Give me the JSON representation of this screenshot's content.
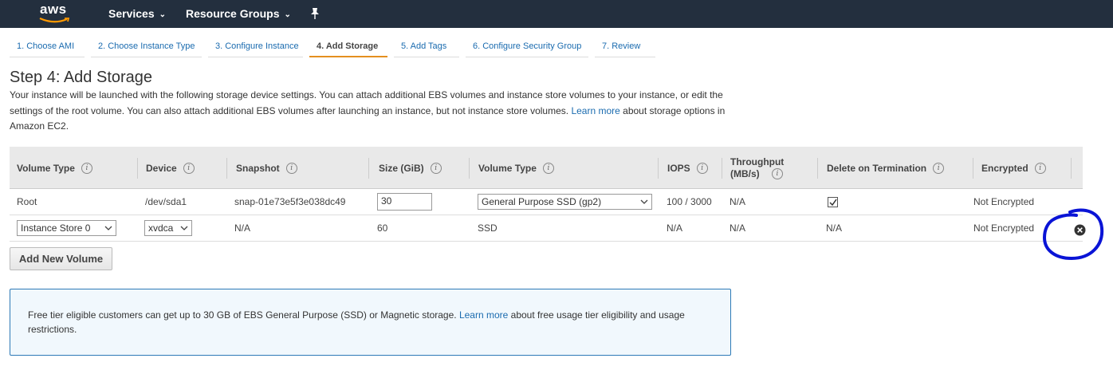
{
  "nav": {
    "logo": "aws",
    "items": [
      {
        "label": "Services"
      },
      {
        "label": "Resource Groups"
      }
    ]
  },
  "tabs": [
    {
      "label": "1. Choose AMI",
      "active": false
    },
    {
      "label": "2. Choose Instance Type",
      "active": false
    },
    {
      "label": "3. Configure Instance",
      "active": false
    },
    {
      "label": "4. Add Storage",
      "active": true
    },
    {
      "label": "5. Add Tags",
      "active": false
    },
    {
      "label": "6. Configure Security Group",
      "active": false
    },
    {
      "label": "7. Review",
      "active": false
    }
  ],
  "page": {
    "title": "Step 4: Add Storage",
    "desc_1": "Your instance will be launched with the following storage device settings. You can attach additional EBS volumes and instance store volumes to your instance, or edit the settings of the root volume. You can also attach additional EBS volumes after launching an instance, but not instance store volumes.",
    "desc_link": "Learn more",
    "desc_2": "about storage options in Amazon EC2."
  },
  "table": {
    "headers": {
      "volume_type": "Volume Type",
      "device": "Device",
      "snapshot": "Snapshot",
      "size": "Size (GiB)",
      "volume_type2": "Volume Type",
      "iops": "IOPS",
      "throughput": "Throughput (MB/s)",
      "delete": "Delete on Termination",
      "encrypted": "Encrypted"
    },
    "rows": [
      {
        "volume_type": "Root",
        "device": "/dev/sda1",
        "snapshot": "snap-01e73e5f3e038dc49",
        "size": "30",
        "ebs_type": "General Purpose SSD (gp2)",
        "iops": "100 / 3000",
        "throughput": "N/A",
        "delete_on_termination": true,
        "encrypted": "Not Encrypted"
      },
      {
        "volume_type": "Instance Store 0",
        "device": "xvdca",
        "snapshot": "N/A",
        "size": "60",
        "ebs_type": "SSD",
        "iops": "N/A",
        "throughput": "N/A",
        "delete_on_termination": "N/A",
        "encrypted": "Not Encrypted"
      }
    ]
  },
  "buttons": {
    "add_volume": "Add New Volume"
  },
  "info": {
    "text_1": "Free tier eligible customers can get up to 30 GB of EBS General Purpose (SSD) or Magnetic storage.",
    "link": "Learn more",
    "text_2": "about free usage tier eligibility and usage restrictions."
  },
  "colors": {
    "nav_bg": "#232f3e",
    "link": "#1a6baf",
    "active_tab_underline": "#e48f1f",
    "annotation": "#0a14d6"
  },
  "icons": [
    "pin-icon",
    "info-icon",
    "chevron-down-icon",
    "checkbox-checked-icon",
    "remove-icon"
  ]
}
